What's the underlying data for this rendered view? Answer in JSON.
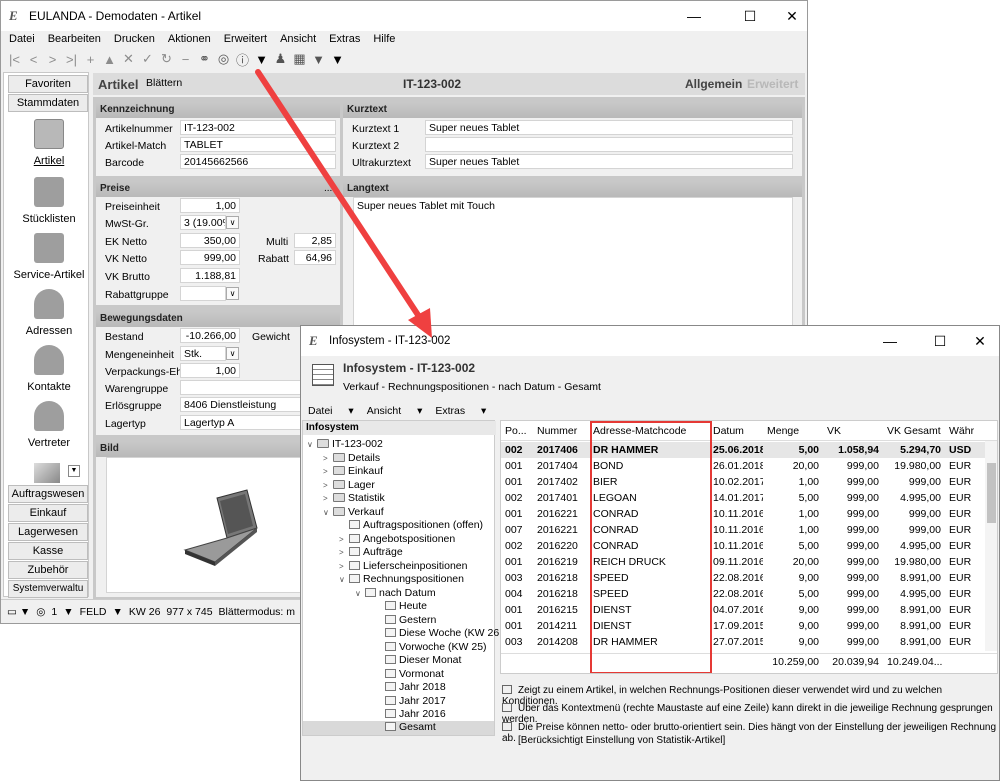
{
  "main": {
    "title": "EULANDA - Demodaten - Artikel",
    "menu": [
      "Datei",
      "Bearbeiten",
      "Drucken",
      "Aktionen",
      "Erweitert",
      "Ansicht",
      "Extras",
      "Hilfe"
    ],
    "nav_top": [
      "Favoriten",
      "Stammdaten"
    ],
    "nav_items": [
      "Artikel",
      "Stücklisten",
      "Service-Artikel",
      "Adressen",
      "Kontakte",
      "Vertreter"
    ],
    "nav_bottom": [
      "Auftragswesen",
      "Einkauf",
      "Lagerwesen",
      "Kasse",
      "Zubehör",
      "Systemverwaltu"
    ],
    "header": {
      "label": "Artikel",
      "sub": "Blättern",
      "id": "IT-123-002",
      "tab_active": "Allgemein",
      "tab_inactive": "Erweitert"
    },
    "kennzeichnung": {
      "title": "Kennzeichnung",
      "rows": [
        {
          "label": "Artikelnummer",
          "value": "IT-123-002"
        },
        {
          "label": "Artikel-Match",
          "value": "TABLET"
        },
        {
          "label": "Barcode",
          "value": "20145662566"
        }
      ]
    },
    "kurztext": {
      "title": "Kurztext",
      "rows": [
        {
          "label": "Kurztext 1",
          "value": "Super neues Tablet"
        },
        {
          "label": "Kurztext 2",
          "value": ""
        },
        {
          "label": "Ultrakurztext",
          "value": "Super neues Tablet"
        }
      ]
    },
    "preise": {
      "title": "Preise",
      "rows": [
        {
          "label": "Preiseinheit",
          "value": "1,00"
        },
        {
          "label": "MwSt-Gr.",
          "value": "3 (19.00%)"
        },
        {
          "label": "EK Netto",
          "value": "350,00"
        },
        {
          "label": "VK Netto",
          "value": "999,00"
        },
        {
          "label": "VK Brutto",
          "value": "1.188,81"
        },
        {
          "label": "Rabattgruppe",
          "value": ""
        }
      ],
      "multi_label": "Multi",
      "multi_value": "2,85",
      "rabatt_label": "Rabatt",
      "rabatt_value": "64,96",
      "more": "..."
    },
    "langtext": {
      "title": "Langtext",
      "value": "Super neues Tablet mit Touch"
    },
    "bewegung": {
      "title": "Bewegungsdaten",
      "rows": [
        {
          "label": "Bestand",
          "value": "-10.266,00"
        },
        {
          "label": "Mengeneinheit",
          "value": "Stk."
        },
        {
          "label": "Verpackungs-Eh",
          "value": "1,00"
        },
        {
          "label": "Warengruppe",
          "value": ""
        },
        {
          "label": "Erlösgruppe",
          "value": "8406 Dienstleistung"
        },
        {
          "label": "Lagertyp",
          "value": "Lagertyp A"
        }
      ],
      "gewicht_label": "Gewicht"
    },
    "bild": {
      "title": "Bild"
    },
    "status": {
      "num": "1",
      "mode": "FELD",
      "kw": "KW 26",
      "size": "977 x 745",
      "text": "Blättermodus: m"
    }
  },
  "info": {
    "title": "Infosystem - IT-123-002",
    "heading": "Infosystem - IT-123-002",
    "subheading": "Verkauf - Rechnungspositionen - nach Datum - Gesamt",
    "menu": [
      "Datei",
      "Ansicht",
      "Extras"
    ],
    "tree_title": "Infosystem",
    "tree": [
      "IT-123-002",
      "Details",
      "Einkauf",
      "Lager",
      "Statistik",
      "Verkauf",
      "Auftragspositionen (offen)",
      "Angebotspositionen",
      "Aufträge",
      "Lieferscheinpositionen",
      "Rechnungspositionen",
      "nach Datum",
      "Heute",
      "Gestern",
      "Diese Woche (KW 26",
      "Vorwoche (KW 25)",
      "Dieser Monat",
      "Vormonat",
      "Jahr 2018",
      "Jahr 2017",
      "Jahr 2016",
      "Gesamt"
    ],
    "columns": [
      "Po...",
      "Nummer",
      "Adresse-Matchcode",
      "Datum",
      "Menge",
      "VK",
      "VK Gesamt",
      "Währ"
    ],
    "rows": [
      [
        "002",
        "2017406",
        "DR HAMMER",
        "25.06.2018",
        "5,00",
        "1.058,94",
        "5.294,70",
        "USD"
      ],
      [
        "001",
        "2017404",
        "BOND",
        "26.01.2018",
        "20,00",
        "999,00",
        "19.980,00",
        "EUR"
      ],
      [
        "001",
        "2017402",
        "BIER",
        "10.02.2017",
        "1,00",
        "999,00",
        "999,00",
        "EUR"
      ],
      [
        "002",
        "2017401",
        "LEGOAN",
        "14.01.2017",
        "5,00",
        "999,00",
        "4.995,00",
        "EUR"
      ],
      [
        "001",
        "2016221",
        "CONRAD",
        "10.11.2016",
        "1,00",
        "999,00",
        "999,00",
        "EUR"
      ],
      [
        "007",
        "2016221",
        "CONRAD",
        "10.11.2016",
        "1,00",
        "999,00",
        "999,00",
        "EUR"
      ],
      [
        "002",
        "2016220",
        "CONRAD",
        "10.11.2016",
        "5,00",
        "999,00",
        "4.995,00",
        "EUR"
      ],
      [
        "001",
        "2016219",
        "REICH DRUCK",
        "09.11.2016",
        "20,00",
        "999,00",
        "19.980,00",
        "EUR"
      ],
      [
        "003",
        "2016218",
        "SPEED",
        "22.08.2016",
        "9,00",
        "999,00",
        "8.991,00",
        "EUR"
      ],
      [
        "004",
        "2016218",
        "SPEED",
        "22.08.2016",
        "5,00",
        "999,00",
        "4.995,00",
        "EUR"
      ],
      [
        "001",
        "2016215",
        "DIENST",
        "04.07.2016",
        "9,00",
        "999,00",
        "8.991,00",
        "EUR"
      ],
      [
        "001",
        "2014211",
        "DIENST",
        "17.09.2015",
        "9,00",
        "999,00",
        "8.991,00",
        "EUR"
      ],
      [
        "003",
        "2014208",
        "DR HAMMER",
        "27.07.2015",
        "9,00",
        "999,00",
        "8.991,00",
        "EUR"
      ]
    ],
    "totals": {
      "menge": "10.259,00",
      "vk": "20.039,94",
      "vk_gesamt": "10.249.04..."
    },
    "hints": [
      "Zeigt zu einem Artikel, in welchen Rechnungs-Positionen dieser verwendet wird und zu welchen Konditionen.",
      "Über das Kontextmenü (rechte Maustaste auf eine Zeile) kann direkt in die jeweilige Rechnung gesprungen werden.",
      "Die Preise können netto- oder brutto-orientiert sein. Dies hängt von der Einstellung der jeweiligen Rechnung ab.",
      "[Berücksichtigt Einstellung von Statistik-Artikel]"
    ]
  },
  "colors": {
    "highlight": "#e53935",
    "arrow": "#ef4040"
  }
}
